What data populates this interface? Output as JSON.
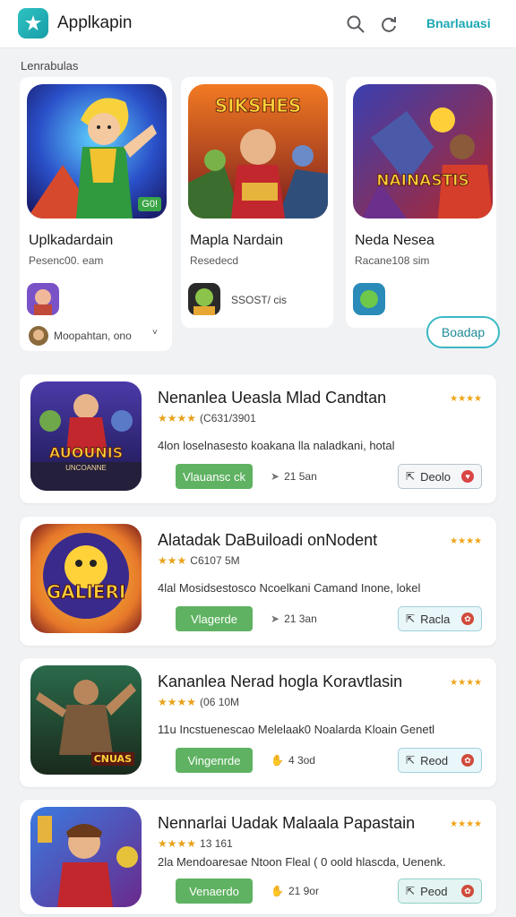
{
  "header": {
    "app_title": "Applkapin",
    "right_link": "Bnarlauasi",
    "search_icon": "search-icon",
    "refresh_icon": "refresh-icon"
  },
  "section_label": "Lenrabulas",
  "featured": [
    {
      "title": "Uplkadardain",
      "subtitle": "Pesenc00. eam",
      "badge": "G0!",
      "row2_text": "Moopahtan, ono",
      "row2_extra": "˅"
    },
    {
      "title": "Mapla Nardain",
      "subtitle": "Resedecd",
      "row1_text": "SSOST/ cis"
    },
    {
      "title": "Neda Nesea",
      "subtitle": "Racane108 sim"
    }
  ],
  "featured_art_text": [
    "SIKSHES",
    "NAINASTIS"
  ],
  "side_button": "Boadap",
  "list": [
    {
      "title": "Nenanlea Ueasla Mlad Candtan",
      "stars": "★★★★",
      "meta": "(C631/3901",
      "desc": "4lon loselnasesto koakana lla naladkani, hotal",
      "button": "Vlauansc ck",
      "size": "21 5an",
      "pill": "Deolo",
      "art_text": "AUOUNIS",
      "art_sub": "UNCOANNE",
      "top_rating": "★★★★"
    },
    {
      "title": "Alatadak DaBuiloadi onNodent",
      "stars": "★★★",
      "meta": "C6107 5M",
      "desc": "4lal Mosidsestosco Ncoelkani Camand Inone, lokel",
      "button": "Vlagerde",
      "size": "21 3an",
      "pill": "Racla",
      "art_text": "GALIERI",
      "top_rating": "★★★★"
    },
    {
      "title": "Kananlea Nerad hogla Koravtlasin",
      "stars": "★★★★",
      "meta": "(06 10M",
      "desc": "11u Incstuenescao Melelaak0 Noalarda Kloain Genetl",
      "button": "Vingenrde",
      "size": "4 3od",
      "pill": "Reod",
      "art_text": "CNUAS",
      "top_rating": "★★★★"
    },
    {
      "title": "Nennarlai Uadak Malaala Papastain",
      "stars": "★★★★",
      "meta": "13 161",
      "desc": "2la Mendoaresae Ntoon Fleal ( 0 oold hlascda, Uenenk.",
      "button": "Venaerdo",
      "size": "21 9or",
      "pill": "Peod",
      "art_text": "",
      "top_rating": "★★★★"
    }
  ],
  "colors": {
    "accent": "#1aa7b3",
    "download_green": "#5fb262",
    "star": "#e8a21a"
  }
}
